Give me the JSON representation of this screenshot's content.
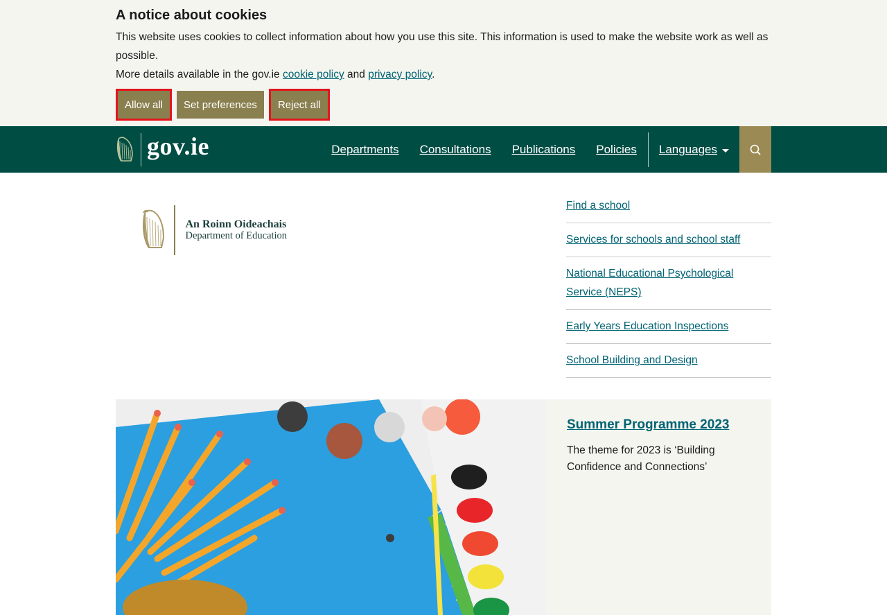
{
  "cookie_banner": {
    "title": "A notice about cookies",
    "text1": "This website uses cookies to collect information about how you use this site. This information is used to make the website work as well as possible.",
    "text2_prefix": "More details available in the gov.ie ",
    "cookie_policy_link": "cookie policy",
    "and": " and ",
    "privacy_policy_link": "privacy policy",
    "text2_suffix": ".",
    "buttons": {
      "allow_all": "Allow all",
      "set_preferences": "Set preferences",
      "reject_all": "Reject all"
    }
  },
  "header": {
    "logo_text": "gov.ie",
    "nav": [
      "Departments",
      "Consultations",
      "Publications",
      "Policies"
    ],
    "languages": "Languages"
  },
  "department": {
    "name_ga": "An Roinn Oideachais",
    "name_en": "Department of Education"
  },
  "quick_links": [
    "Find a school",
    "Services for schools and school staff",
    "National Educational Psychological Service (NEPS)",
    "Early Years Education Inspections",
    "School Building and Design"
  ],
  "feature": {
    "title": "Summer Programme 2023",
    "text": "The theme for 2023 is ‘Building Confidence and Connections’"
  },
  "colors": {
    "header_bg": "#004d44",
    "button_bg": "#8a7f4e",
    "focus_outline": "#e3151c",
    "link": "#006373",
    "search_bg": "#9c8a55"
  }
}
